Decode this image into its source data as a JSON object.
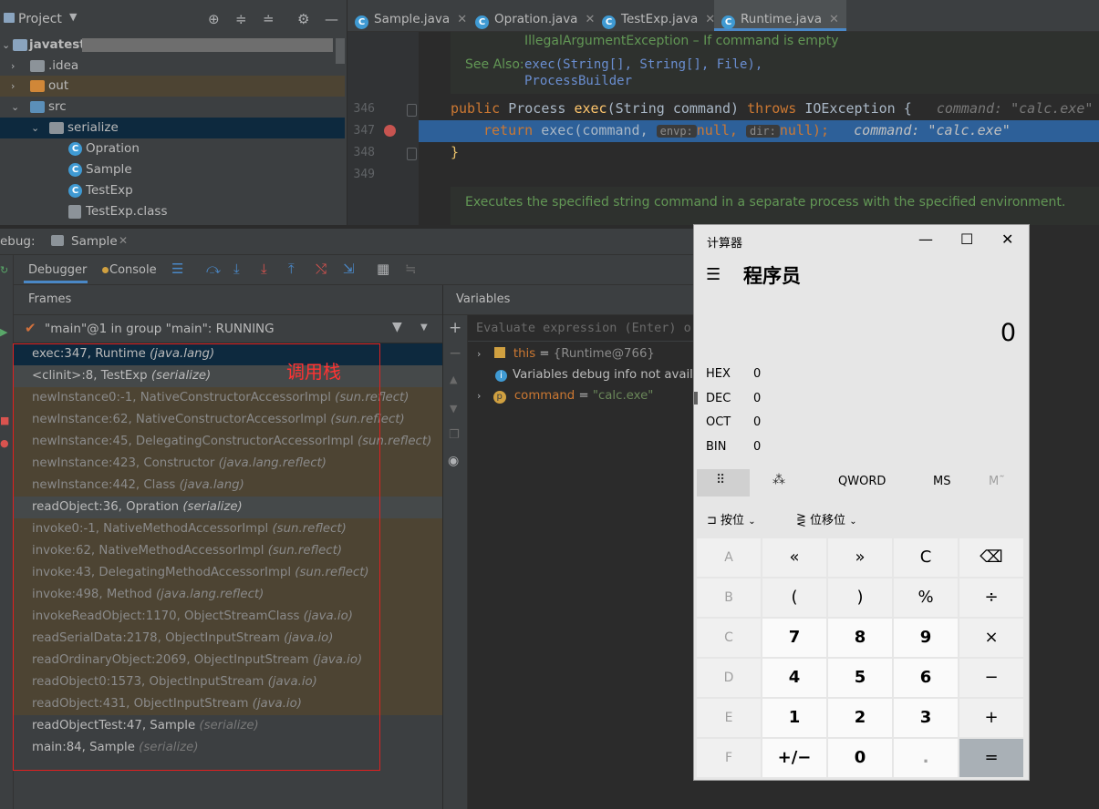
{
  "project": {
    "title": "Project",
    "tree": [
      {
        "label": "javatest",
        "indent": 0
      },
      {
        "label": ".idea",
        "indent": 1
      },
      {
        "label": "out",
        "indent": 1
      },
      {
        "label": "src",
        "indent": 1
      },
      {
        "label": "serialize",
        "indent": 2
      },
      {
        "label": "Opration",
        "indent": 3
      },
      {
        "label": "Sample",
        "indent": 3
      },
      {
        "label": "TestExp",
        "indent": 3
      },
      {
        "label": "TestExp.class",
        "indent": 3
      }
    ]
  },
  "editor": {
    "tabs": [
      {
        "label": "Sample.java"
      },
      {
        "label": "Opration.java"
      },
      {
        "label": "TestExp.java"
      },
      {
        "label": "Runtime.java"
      }
    ],
    "doc_throws": "IllegalArgumentException – If command is empty",
    "doc_see_also_label": "See Also:",
    "doc_see_also_1": "exec(String[], String[], File),",
    "doc_see_also_2": "ProcessBuilder",
    "line_numbers": [
      "346",
      "347",
      "348",
      "349"
    ],
    "line346": {
      "kw1": "public",
      "type": "Process",
      "fn": "exec",
      "params": "(String command)",
      "kw2": "throws",
      "exc": "IOException {",
      "hint": "command: \"calc.exe\""
    },
    "line347": {
      "kw": "return",
      "call": "exec(command,",
      "envp": "envp:",
      "null1": "null,",
      "dir": "dir:",
      "null2": "null);",
      "hint": "command: \"calc.exe\""
    },
    "line348": "}",
    "doc_next": "Executes the specified string command in a separate process with the specified environment."
  },
  "debug": {
    "label": "ebug:",
    "session_tab": "Sample",
    "tabs": {
      "debugger": "Debugger",
      "console": "Console"
    },
    "frames_title": "Frames",
    "variables_title": "Variables",
    "thread": "\"main\"@1 in group \"main\": RUNNING",
    "frames": [
      {
        "method": "exec:347, Runtime",
        "pkg": "(java.lang)",
        "kind": "sel"
      },
      {
        "method": "<clinit>:8, TestExp",
        "pkg": "(serialize)",
        "kind": "gray"
      },
      {
        "method": "newInstance0:-1, NativeConstructorAccessorImpl",
        "pkg": "(sun.reflect)",
        "kind": "lib"
      },
      {
        "method": "newInstance:62, NativeConstructorAccessorImpl",
        "pkg": "(sun.reflect)",
        "kind": "lib"
      },
      {
        "method": "newInstance:45, DelegatingConstructorAccessorImpl",
        "pkg": "(sun.reflect)",
        "kind": "lib"
      },
      {
        "method": "newInstance:423, Constructor",
        "pkg": "(java.lang.reflect)",
        "kind": "lib"
      },
      {
        "method": "newInstance:442, Class",
        "pkg": "(java.lang)",
        "kind": "lib"
      },
      {
        "method": "readObject:36, Opration",
        "pkg": "(serialize)",
        "kind": "gray"
      },
      {
        "method": "invoke0:-1, NativeMethodAccessorImpl",
        "pkg": "(sun.reflect)",
        "kind": "lib"
      },
      {
        "method": "invoke:62, NativeMethodAccessorImpl",
        "pkg": "(sun.reflect)",
        "kind": "lib"
      },
      {
        "method": "invoke:43, DelegatingMethodAccessorImpl",
        "pkg": "(sun.reflect)",
        "kind": "lib"
      },
      {
        "method": "invoke:498, Method",
        "pkg": "(java.lang.reflect)",
        "kind": "lib"
      },
      {
        "method": "invokeReadObject:1170, ObjectStreamClass",
        "pkg": "(java.io)",
        "kind": "lib"
      },
      {
        "method": "readSerialData:2178, ObjectInputStream",
        "pkg": "(java.io)",
        "kind": "lib"
      },
      {
        "method": "readOrdinaryObject:2069, ObjectInputStream",
        "pkg": "(java.io)",
        "kind": "lib"
      },
      {
        "method": "readObject0:1573, ObjectInputStream",
        "pkg": "(java.io)",
        "kind": "lib"
      },
      {
        "method": "readObject:431, ObjectInputStream",
        "pkg": "(java.io)",
        "kind": "lib"
      },
      {
        "method": "readObjectTest:47, Sample",
        "pkg": "(serialize)",
        "kind": "normal"
      },
      {
        "method": "main:84, Sample",
        "pkg": "(serialize)",
        "kind": "normal"
      }
    ],
    "stack_annotation": "调用栈",
    "eval_placeholder": "Evaluate expression (Enter) or",
    "vars": {
      "this_name": "this",
      "this_val": "{Runtime@766}",
      "info": "Variables debug info not availab",
      "cmd_name": "command",
      "cmd_val": "\"calc.exe\""
    }
  },
  "calculator": {
    "title": "计算器",
    "mode": "程序员",
    "display": "0",
    "radix": [
      {
        "label": "HEX",
        "value": "0"
      },
      {
        "label": "DEC",
        "value": "0"
      },
      {
        "label": "OCT",
        "value": "0"
      },
      {
        "label": "BIN",
        "value": "0"
      }
    ],
    "word_size": "QWORD",
    "ms": "MS",
    "mplus": "M˜",
    "bitwise": "按位",
    "bitshift": "位移位",
    "keys": [
      [
        "A",
        "«",
        "»",
        "C",
        "⌫"
      ],
      [
        "B",
        "(",
        ")",
        "%",
        "÷"
      ],
      [
        "C",
        "7",
        "8",
        "9",
        "×"
      ],
      [
        "D",
        "4",
        "5",
        "6",
        "−"
      ],
      [
        "E",
        "1",
        "2",
        "3",
        "+"
      ],
      [
        "F",
        "+/−",
        "0",
        ".",
        "="
      ]
    ]
  },
  "colors": {
    "accent": "#2d6099",
    "selection": "#0d293e",
    "library_frame": "#4d4433",
    "annotation": "#e02020"
  }
}
